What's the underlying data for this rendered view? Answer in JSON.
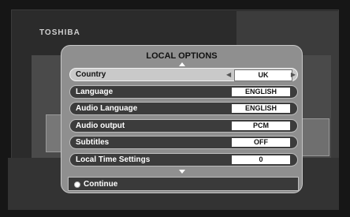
{
  "brand": {
    "logo_text": "TOSHIBA"
  },
  "dialog": {
    "title": "LOCAL OPTIONS",
    "rows": [
      {
        "label": "Country",
        "value": "UK",
        "selected": true
      },
      {
        "label": "Language",
        "value": "ENGLISH"
      },
      {
        "label": "Audio Language",
        "value": "ENGLISH"
      },
      {
        "label": "Audio output",
        "value": "PCM"
      },
      {
        "label": "Subtitles",
        "value": "OFF"
      },
      {
        "label": "Local Time Settings",
        "value": "0"
      }
    ],
    "continue_label": "Continue"
  },
  "colors": {
    "dialog_bg": "#8f8f8f",
    "row_bg": "#3c3c3c",
    "row_selected_bg": "#c9c9c9",
    "value_bg": "#ffffff"
  }
}
